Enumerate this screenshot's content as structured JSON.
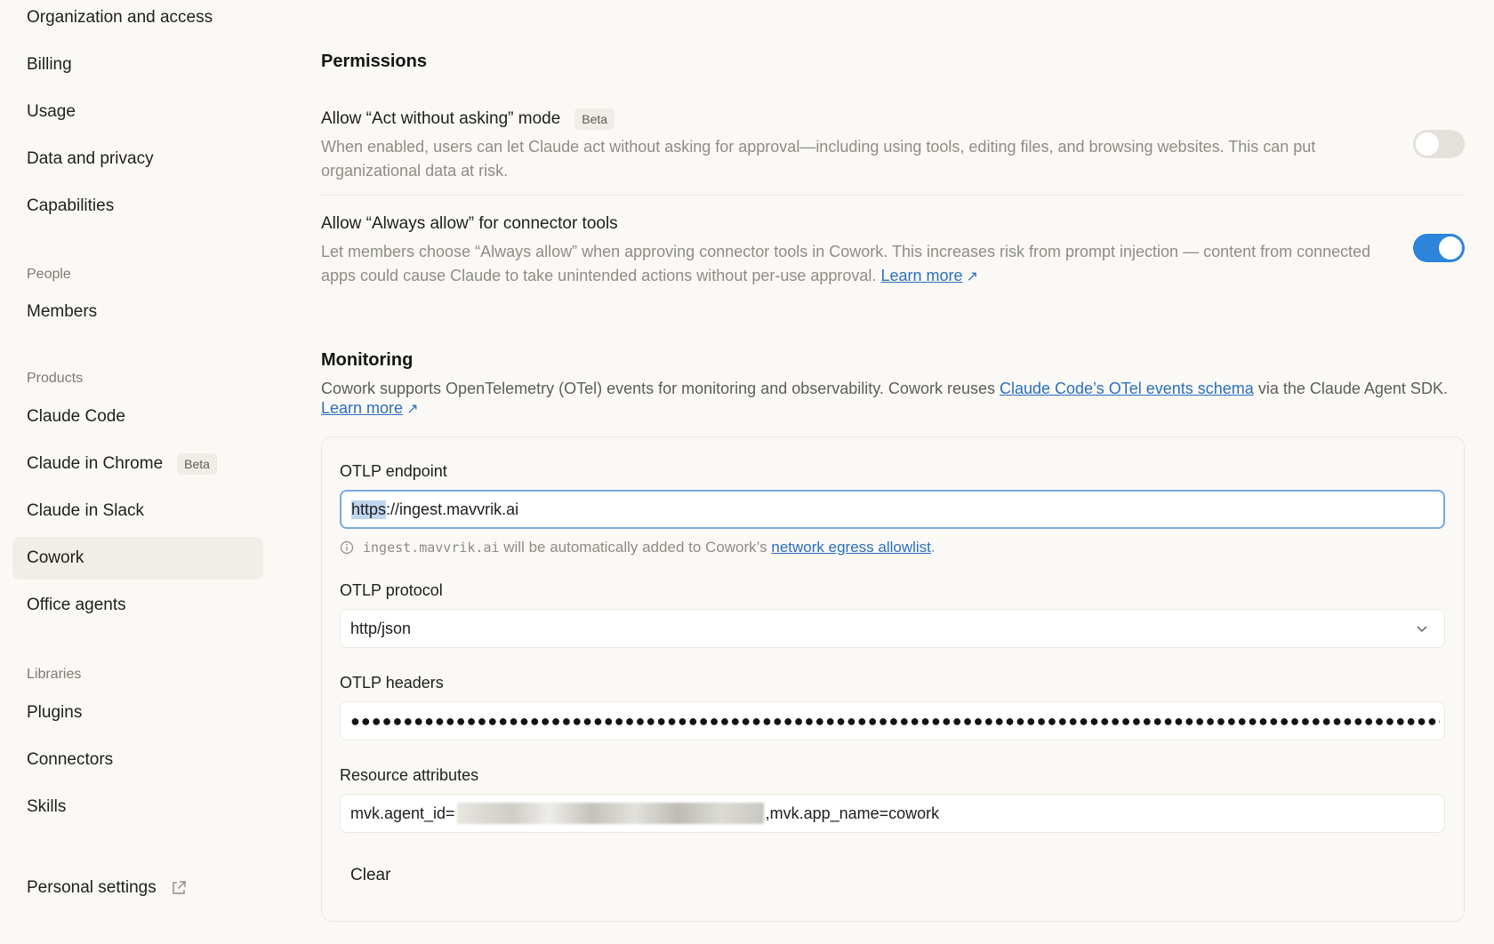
{
  "sidebar": {
    "items": [
      {
        "label": "Organization and access"
      },
      {
        "label": "Billing"
      },
      {
        "label": "Usage"
      },
      {
        "label": "Data and privacy"
      },
      {
        "label": "Capabilities"
      }
    ],
    "people_heading": "People",
    "people_items": [
      {
        "label": "Members"
      }
    ],
    "products_heading": "Products",
    "products_items": [
      {
        "label": "Claude Code"
      },
      {
        "label": "Claude in Chrome",
        "badge": "Beta"
      },
      {
        "label": "Claude in Slack"
      },
      {
        "label": "Cowork",
        "active": true
      },
      {
        "label": "Office agents"
      }
    ],
    "libraries_heading": "Libraries",
    "libraries_items": [
      {
        "label": "Plugins"
      },
      {
        "label": "Connectors"
      },
      {
        "label": "Skills"
      }
    ],
    "personal_settings": "Personal settings"
  },
  "permissions": {
    "title": "Permissions",
    "act_without_asking": {
      "title": "Allow “Act without asking” mode",
      "badge": "Beta",
      "description": "When enabled, users can let Claude act without asking for approval—including using tools, editing files, and browsing websites. This can put organizational data at risk.",
      "enabled": false
    },
    "always_allow": {
      "title": "Allow “Always allow” for connector tools",
      "description": "Let members choose “Always allow” when approving connector tools in Cowork. This increases risk from prompt injection — content from connected apps could cause Claude to take unintended actions without per-use approval.",
      "learn_more": "Learn more",
      "enabled": true
    }
  },
  "monitoring": {
    "title": "Monitoring",
    "desc_part1": "Cowork supports OpenTelemetry (OTel) events for monitoring and observability. Cowork reuses ",
    "desc_link": "Claude Code’s OTel events schema",
    "desc_part2": " via the Claude Agent SDK.",
    "learn_more": "Learn more",
    "otlp_endpoint": {
      "label": "OTLP endpoint",
      "value_selected": "https",
      "value_rest": "://ingest.mavvrik.ai",
      "hint_domain": "ingest.mavvrik.ai",
      "hint_text": " will be automatically added to Cowork’s ",
      "hint_link": "network egress allowlist",
      "hint_end": "."
    },
    "otlp_protocol": {
      "label": "OTLP protocol",
      "value": "http/json"
    },
    "otlp_headers": {
      "label": "OTLP headers",
      "value": "●●●●●●●●●●●●●●●●●●●●●●●●●●●●●●●●●●●●●●●●●●●●●●●●●●●●●●●●●●●●●●●●●●●●●●●●●●●●●●●●●●●●●●●●●●●●●●●●●●●●●●●●●●●●●●●●●●●●●"
    },
    "resource_attributes": {
      "label": "Resource attributes",
      "value_prefix": "mvk.agent_id=",
      "value_suffix": ",mvk.app_name=cowork"
    },
    "clear_label": "Clear"
  },
  "colors": {
    "accent": "#2c84db",
    "link": "#2c6fbf",
    "background": "#faf9f5",
    "active_nav": "#f0eee6"
  }
}
